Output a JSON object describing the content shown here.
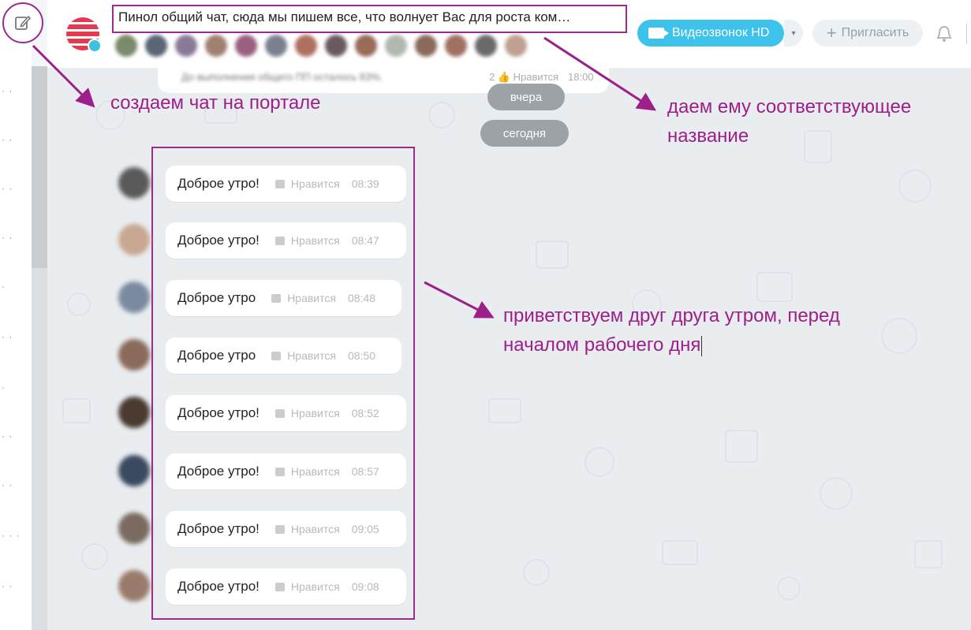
{
  "chat": {
    "title": "Пинол  общий чат, сюда мы пишем все, что волнует Вас для роста ком…",
    "prev_message_text": "До выполнения общего ПП осталось 83%.",
    "prev_message_count": "2",
    "like_label": "Нравится",
    "prev_message_time": "18:00"
  },
  "header": {
    "video_button": "Видеозвонок HD",
    "video_dropdown": "▾",
    "invite_button": "Пригласить",
    "invite_plus": "+",
    "bell_icon": "🔔"
  },
  "dates": {
    "yesterday": "вчера",
    "today": "сегодня"
  },
  "messages": [
    {
      "text": "Доброе утро!",
      "like": "Нравится",
      "time": "08:39"
    },
    {
      "text": "Доброе утро!",
      "like": "Нравится",
      "time": "08:47"
    },
    {
      "text": "Доброе утро",
      "like": "Нравится",
      "time": "08:48"
    },
    {
      "text": "Доброе утро",
      "like": "Нравится",
      "time": "08:50"
    },
    {
      "text": "Доброе утро!",
      "like": "Нравится",
      "time": "08:52"
    },
    {
      "text": "Доброе утро!",
      "like": "Нравится",
      "time": "08:57"
    },
    {
      "text": "Доброе утро!",
      "like": "Нравится",
      "time": "09:05"
    },
    {
      "text": "Доброе утро!",
      "like": "Нравится",
      "time": "09:08"
    }
  ],
  "annotations": {
    "create_chat": "создаем чат на портале",
    "name_chat_line1": "даем ему соответствующее",
    "name_chat_line2": "название",
    "greet_line1": "приветствуем друг друга утром, перед",
    "greet_line2": "началом рабочего дня"
  },
  "colors": {
    "annotation": "#9c1f8a",
    "video_button": "#3dc2ec",
    "date_pill": "#9da2a6"
  }
}
